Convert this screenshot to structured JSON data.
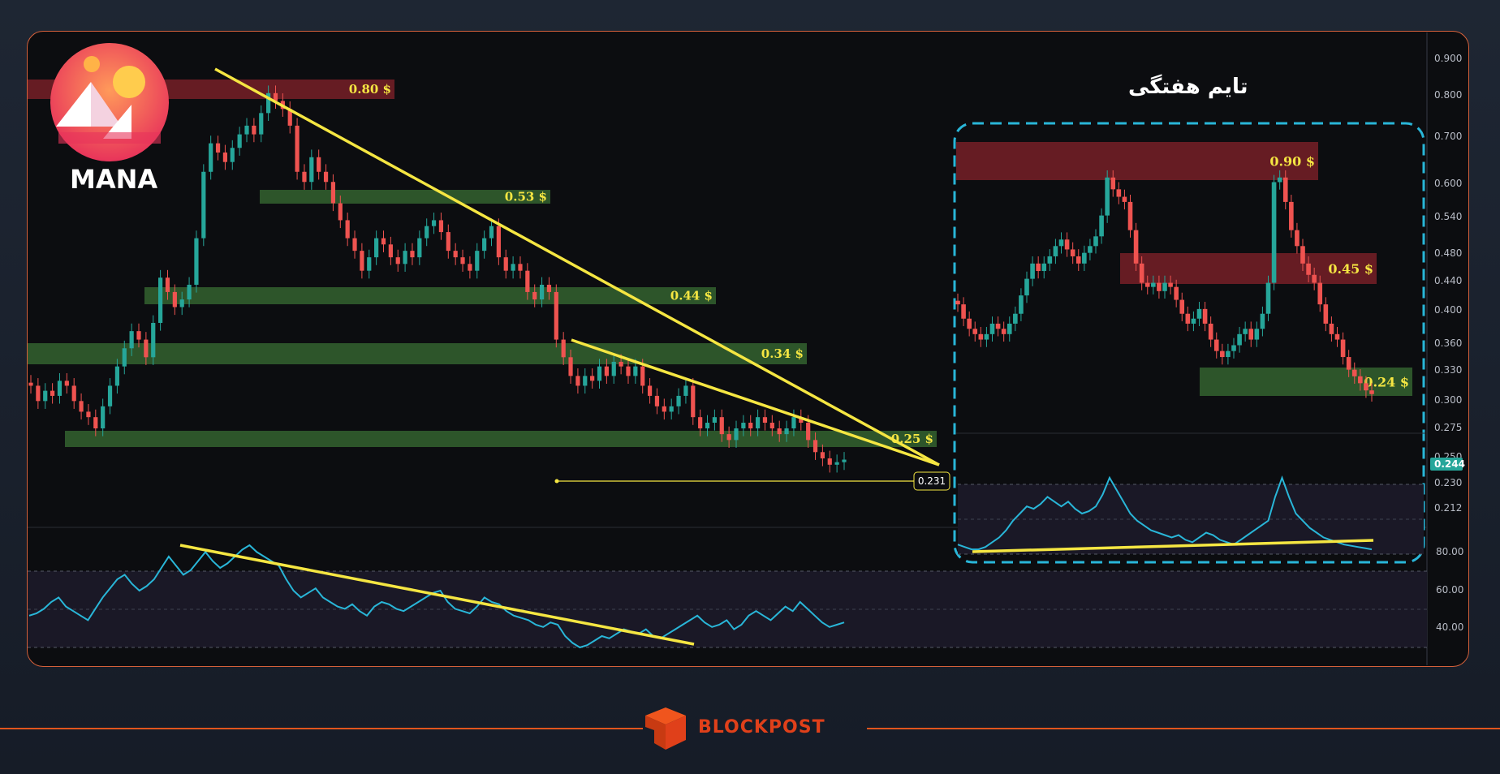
{
  "asset": {
    "name": "MANA"
  },
  "inset": {
    "title": "تایم هفتگی"
  },
  "brand": {
    "name": "BLOCKPOST"
  },
  "colors": {
    "bull": "#26a69a",
    "bear": "#ef5350",
    "trend": "#f5e642",
    "rsi": "#29b6d8",
    "support": "#2f5a2c",
    "resistance": "#6b1e25",
    "accent": "#e0551d"
  },
  "chart_data": [
    {
      "type": "candlestick",
      "title": "MANA",
      "price_axis": {
        "ticks": [
          "0.900",
          "0.800",
          "0.700",
          "0.600",
          "0.540",
          "0.480",
          "0.440",
          "0.400",
          "0.360",
          "0.330",
          "0.300",
          "0.275",
          "0.250",
          "0.230",
          "0.212"
        ],
        "scale": "log",
        "current_price": "0.244"
      },
      "zones": [
        {
          "kind": "resistance",
          "label": "0.80 $",
          "price": 0.8
        },
        {
          "kind": "support",
          "label": "0.53 $",
          "price": 0.53
        },
        {
          "kind": "support",
          "label": "0.44 $",
          "price": 0.44
        },
        {
          "kind": "support",
          "label": "0.34 $",
          "price": 0.34
        },
        {
          "kind": "support",
          "label": "0.25 $",
          "price": 0.25
        }
      ],
      "trendlines": [
        "descending from 0.86 high",
        "descending from 0.335"
      ],
      "level_line": {
        "label": "0.231",
        "price": 0.231
      },
      "closes": [
        0.31,
        0.295,
        0.305,
        0.3,
        0.315,
        0.31,
        0.295,
        0.285,
        0.28,
        0.27,
        0.29,
        0.31,
        0.33,
        0.35,
        0.37,
        0.36,
        0.34,
        0.38,
        0.44,
        0.42,
        0.4,
        0.41,
        0.43,
        0.5,
        0.62,
        0.68,
        0.66,
        0.64,
        0.67,
        0.7,
        0.72,
        0.7,
        0.75,
        0.8,
        0.78,
        0.76,
        0.72,
        0.62,
        0.6,
        0.65,
        0.62,
        0.6,
        0.56,
        0.53,
        0.5,
        0.48,
        0.45,
        0.47,
        0.5,
        0.49,
        0.47,
        0.46,
        0.48,
        0.47,
        0.5,
        0.52,
        0.53,
        0.51,
        0.48,
        0.47,
        0.46,
        0.45,
        0.48,
        0.5,
        0.52,
        0.47,
        0.45,
        0.46,
        0.45,
        0.42,
        0.41,
        0.43,
        0.42,
        0.36,
        0.34,
        0.32,
        0.31,
        0.32,
        0.315,
        0.33,
        0.32,
        0.335,
        0.33,
        0.32,
        0.33,
        0.31,
        0.3,
        0.29,
        0.285,
        0.29,
        0.3,
        0.31,
        0.28,
        0.27,
        0.275,
        0.28,
        0.265,
        0.26,
        0.27,
        0.275,
        0.27,
        0.28,
        0.275,
        0.27,
        0.265,
        0.27,
        0.28,
        0.275,
        0.26,
        0.25,
        0.245,
        0.24,
        0.242,
        0.244
      ],
      "rsi": {
        "ticks": [
          "80.00",
          "60.00",
          "40.00"
        ],
        "values": [
          44,
          45,
          47,
          50,
          52,
          48,
          46,
          44,
          42,
          47,
          52,
          56,
          60,
          62,
          58,
          55,
          57,
          60,
          65,
          70,
          66,
          62,
          64,
          68,
          72,
          68,
          65,
          67,
          70,
          73,
          75,
          72,
          70,
          68,
          66,
          60,
          55,
          52,
          54,
          56,
          52,
          50,
          48,
          47,
          49,
          46,
          44,
          48,
          50,
          49,
          47,
          46,
          48,
          50,
          52,
          54,
          55,
          50,
          47,
          46,
          45,
          48,
          52,
          50,
          49,
          46,
          44,
          43,
          42,
          40,
          39,
          41,
          40,
          35,
          32,
          30,
          31,
          33,
          35,
          34,
          36,
          38,
          37,
          36,
          38,
          35,
          34,
          36,
          38,
          40,
          42,
          44,
          41,
          39,
          40,
          42,
          38,
          40,
          44,
          46,
          44,
          42,
          45,
          48,
          46,
          50,
          47,
          44,
          41,
          39,
          40,
          41
        ],
        "trendline": "descending"
      }
    },
    {
      "type": "candlestick",
      "title": "تایم هفتگی",
      "zones": [
        {
          "kind": "resistance",
          "label": "0.90 $",
          "price": 0.9
        },
        {
          "kind": "resistance",
          "label": "0.45 $",
          "price": 0.45
        },
        {
          "kind": "support",
          "label": "0.24 $",
          "price": 0.24
        }
      ],
      "closes": [
        0.4,
        0.37,
        0.35,
        0.34,
        0.33,
        0.34,
        0.36,
        0.35,
        0.34,
        0.36,
        0.38,
        0.42,
        0.46,
        0.5,
        0.48,
        0.5,
        0.52,
        0.55,
        0.57,
        0.54,
        0.52,
        0.5,
        0.53,
        0.55,
        0.58,
        0.65,
        0.8,
        0.75,
        0.72,
        0.7,
        0.6,
        0.5,
        0.45,
        0.44,
        0.45,
        0.43,
        0.45,
        0.44,
        0.41,
        0.38,
        0.36,
        0.37,
        0.39,
        0.36,
        0.33,
        0.31,
        0.3,
        0.31,
        0.32,
        0.34,
        0.35,
        0.33,
        0.35,
        0.38,
        0.45,
        0.78,
        0.8,
        0.7,
        0.6,
        0.55,
        0.5,
        0.47,
        0.45,
        0.4,
        0.36,
        0.34,
        0.33,
        0.3,
        0.28,
        0.27,
        0.26,
        0.25,
        0.245
      ],
      "rsi": {
        "values": [
          42,
          41,
          40,
          40,
          41,
          43,
          45,
          48,
          52,
          55,
          58,
          57,
          59,
          62,
          60,
          58,
          60,
          57,
          55,
          56,
          58,
          63,
          70,
          65,
          60,
          55,
          52,
          50,
          48,
          47,
          46,
          45,
          46,
          44,
          43,
          45,
          47,
          46,
          44,
          43,
          42,
          44,
          46,
          48,
          50,
          52,
          62,
          70,
          62,
          55,
          52,
          49,
          47,
          45,
          44,
          43,
          42,
          41.5,
          41,
          40.5,
          40
        ],
        "trendline": "ascending"
      }
    }
  ]
}
